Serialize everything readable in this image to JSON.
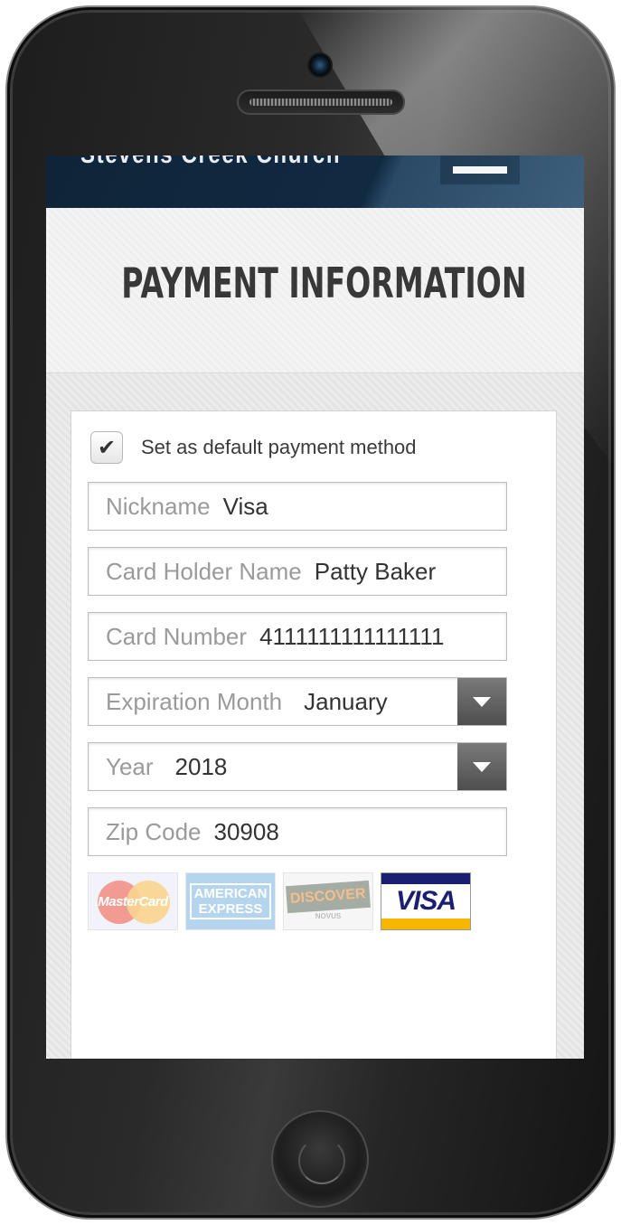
{
  "site": {
    "title": "Stevens Creek Church"
  },
  "page": {
    "title": "PAYMENT INFORMATION"
  },
  "form": {
    "default_checkbox": {
      "label": "Set as default payment method",
      "checked": true,
      "check_glyph": "✔"
    },
    "fields": {
      "nickname": {
        "label": "Nickname",
        "value": "Visa"
      },
      "card_holder": {
        "label": "Card Holder Name",
        "value": "Patty Baker"
      },
      "card_number": {
        "label": "Card Number",
        "value": "4111111111111111"
      },
      "expiration_month": {
        "label": "Expiration Month",
        "value": "January"
      },
      "year": {
        "label": "Year",
        "value": "2018"
      },
      "zip": {
        "label": "Zip Code",
        "value": "30908"
      }
    },
    "card_brands": {
      "mastercard": {
        "text": "MasterCard",
        "selected": false
      },
      "amex": {
        "line1": "AMERICAN",
        "line2": "EXPRESS",
        "selected": false
      },
      "discover": {
        "text": "DISCOVER",
        "sub": "NOVUS",
        "selected": false
      },
      "visa": {
        "text": "VISA",
        "selected": true
      }
    }
  },
  "colors": {
    "header_bg": "#0f2438",
    "select_button": "#5a5a5a",
    "visa_blue": "#1a1f71",
    "visa_gold": "#f7b600"
  },
  "icons": {
    "menu": "hamburger-menu-icon",
    "select": "chevron-down-icon"
  }
}
